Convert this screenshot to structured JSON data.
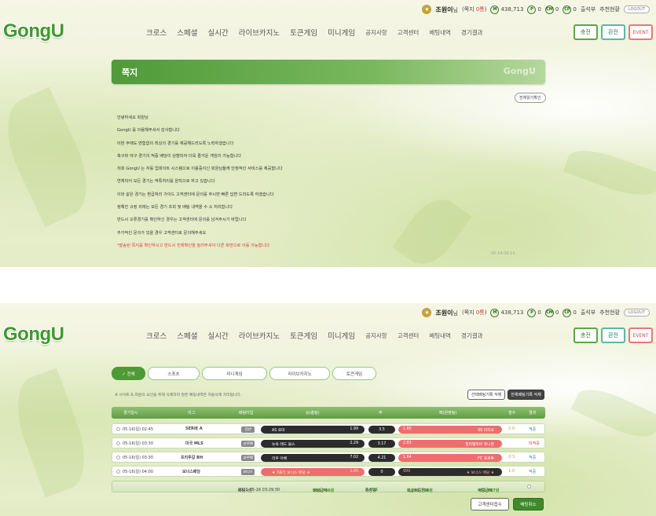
{
  "header": {
    "logo": "GongU",
    "user_icon": "★",
    "username": "조원이",
    "user_suffix": "님",
    "memo_label": "(쪽지",
    "memo_count": "0통",
    "memo_close": ")",
    "balance_badge": "M",
    "balance": "438,713",
    "point_badge": "P",
    "point": "0",
    "cm_badge": "CM",
    "cm": "0",
    "cp_badge": "CP",
    "cp": "0",
    "attendance": "출석부",
    "recommend": "추천현황",
    "logout": "LOGOUT",
    "nav": [
      {
        "label": "크로스"
      },
      {
        "label": "스페셜"
      },
      {
        "label": "실시간"
      },
      {
        "label": "라이브카지노"
      },
      {
        "label": "토큰게임"
      },
      {
        "label": "미니게임"
      },
      {
        "label": "공지사항"
      },
      {
        "label": "고객센터"
      },
      {
        "label": "베팅내역"
      },
      {
        "label": "경기결과"
      }
    ],
    "charge": "충전",
    "exchange": "환전",
    "event": "EVENT"
  },
  "memo": {
    "title": "쪽지",
    "watermark": "GongU",
    "read_all": "전체읽기확인",
    "lines": [
      "안녕하세요 회원님",
      "GongU 를 이용해주셔서 감사합니다",
      "이번 주에도 변함없이 최상의 경기를 제공해드리도록 노력하겠습니다",
      "축구와 야구 경기의 적중 배당이 상향되어 더욱 즐거운 게임이 가능합니다",
      "저희 GongU 는 자동 업데이트 시스템으로 이용중이신 회원님들께 안정적인 서비스를 제공합니다",
      "연체되어 모든 경기는 적특처리를 원칙으로 하고 있습니다",
      "이와 같은 경기는 환급처리 가이드 고객센터에 문의를 주시면 빠른 답변 드리도록 하겠습니다",
      "정해진 규정 외에는 모든 경기 조회 및 베팅 내역을 수 소 처리합니다",
      "반드시 오류경기를 확인하신 경우는 고객센터에 문의를 남겨주시기 바랍니다",
      "추가적인 문의가 있을 경우 고객센터로 문의해주세요",
      "*발송된 쪽지를 확인하시고 반드시 전체확인을 눌러주셔야 다른 화면으로 이동 가능합니다"
    ],
    "date": "05-14 09:15"
  },
  "bet": {
    "tabs": [
      {
        "label": "✓ 전체"
      },
      {
        "label": "스포츠"
      },
      {
        "label": "미니게임"
      },
      {
        "label": "라이브카지노"
      },
      {
        "label": "토큰게임"
      }
    ],
    "notice": "※ 사이트 & 회원의 요인을 위해 삭제하지 않은 베팅내역은 자동삭제 처리됩니다.",
    "delete_selected": "선택베팅기록 삭제",
    "delete_all": "전체베팅기록 삭제",
    "columns": {
      "time": "경기일시",
      "league": "리그",
      "type": "베팅타입",
      "home": "승(홈팀)",
      "draw": "무",
      "away": "패(원정팀)",
      "score": "점수",
      "result": "결과"
    },
    "rows": [
      {
        "time": "05-16(일) 02:45",
        "league": "SERIE A",
        "type": "일반",
        "home": "AS 로마",
        "home_odds": "1.99",
        "draw": "3.5",
        "away_odds": "1.80",
        "away": "SS 라치오",
        "score": "2:0",
        "result": "적중"
      },
      {
        "time": "05-16(일) 03:30",
        "league": "미국 MLS",
        "type": "승무패",
        "home": "뉴욕 레드 불스",
        "home_odds": "2.29",
        "draw": "3.17",
        "away_odds": "2.83",
        "away": "필라델피아 유니온",
        "score": "",
        "result": "미적중"
      },
      {
        "time": "05-16(일) 03:30",
        "league": "프리투갈 BH",
        "type": "승무패",
        "home": "리우 아베",
        "home_odds": "7.02",
        "draw": "4.21",
        "away_odds": "1.64",
        "away": "FC 포르투",
        "score": "0:3",
        "result": "적중"
      },
      {
        "time": "05-16(일) 04:00",
        "league": "보너스배당",
        "type": "보너스",
        "home": "★ 3폴더 보너스 배당 ★",
        "home_odds": "1.05",
        "draw": "0",
        "away_odds": "999",
        "away": "★ 보너스 배당 ★",
        "score": "1:0",
        "result": "적중"
      }
    ],
    "summary": {
      "time_label": "배팅시간",
      "time": "2021-05-16 03:29:30",
      "amount_label": "배팅금액",
      "amount": "168,736원",
      "odds_label": "배당률",
      "odds": "7.596",
      "expected_label": "예상적중금액",
      "expected": "1,281,718원",
      "win_label": "적중금액",
      "win": "452,887원"
    },
    "cancel_btn": "고객센터접수",
    "cancel_bet": "배팅취소"
  }
}
